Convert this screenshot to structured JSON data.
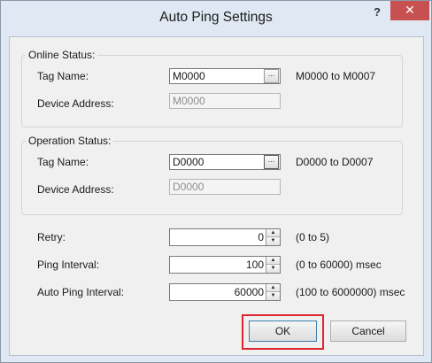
{
  "window": {
    "title": "Auto Ping Settings",
    "help_label": "?",
    "close_label": "✕"
  },
  "online_status": {
    "group_label": "Online Status:",
    "tag_name_label": "Tag Name:",
    "tag_name_value": "M0000",
    "browse_label": "...",
    "tag_range": "M0000 to M0007",
    "device_address_label": "Device Address:",
    "device_address_value": "M0000"
  },
  "operation_status": {
    "group_label": "Operation Status:",
    "tag_name_label": "Tag Name:",
    "tag_name_value": "D0000",
    "browse_label": "...",
    "tag_range": "D0000 to D0007",
    "device_address_label": "Device Address:",
    "device_address_value": "D0000"
  },
  "settings": {
    "retry_label": "Retry:",
    "retry_value": "0",
    "retry_range": "(0 to 5)",
    "ping_interval_label": "Ping Interval:",
    "ping_interval_value": "100",
    "ping_interval_range": "(0 to 60000) msec",
    "auto_ping_interval_label": "Auto Ping Interval:",
    "auto_ping_interval_value": "60000",
    "auto_ping_interval_range": "(100 to 6000000) msec"
  },
  "buttons": {
    "ok_label": "OK",
    "cancel_label": "Cancel"
  },
  "icons": {
    "spin_up": "▲",
    "spin_down": "▼"
  },
  "colors": {
    "highlight": "#e0262c",
    "close_button": "#c75050"
  }
}
